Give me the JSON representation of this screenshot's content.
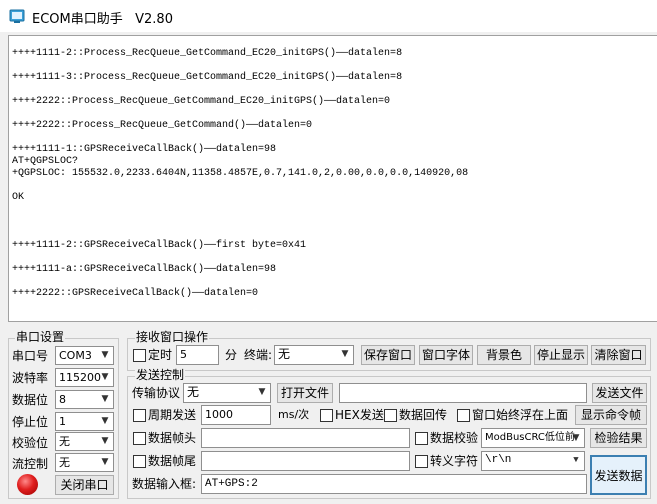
{
  "window": {
    "title": "ECOM串口助手   V2.80"
  },
  "receive": {
    "lines": [
      "++++1111-2::Process_RecQueue_GetCommand_EC20_initGPS()——datalen=8",
      "",
      "++++1111-3::Process_RecQueue_GetCommand_EC20_initGPS()——datalen=8",
      "",
      "++++2222::Process_RecQueue_GetCommand_EC20_initGPS()——datalen=0",
      "",
      "++++2222::Process_RecQueue_GetCommand()——datalen=0",
      "",
      "++++1111-1::GPSReceiveCallBack()——datalen=98",
      "AT+QGPSLOC?",
      "+QGPSLOC: 155532.0,2233.6404N,11358.4857E,0.7,141.0,2,0.00,0.0,0.0,140920,08",
      "",
      "OK",
      "",
      "",
      "",
      "++++1111-2::GPSReceiveCallBack()——first byte=0x41",
      "",
      "++++1111-a::GPSReceiveCallBack()——datalen=98",
      "",
      "++++2222::GPSReceiveCallBack()——datalen=0"
    ]
  },
  "serial_settings": {
    "group_label": "串口设置",
    "port_label": "串口号",
    "port_value": "COM3",
    "baud_label": "波特率",
    "baud_value": "115200",
    "databits_label": "数据位",
    "databits_value": "8",
    "stopbits_label": "停止位",
    "stopbits_value": "1",
    "parity_label": "校验位",
    "parity_value": "无",
    "flow_label": "流控制",
    "flow_value": "无",
    "close_button": "关闭串口"
  },
  "receive_ops": {
    "group_label": "接收窗口操作",
    "timer_label": "定时",
    "timer_value": "5",
    "unit": "分",
    "terminal_label": "终端:",
    "terminal_value": "无",
    "save_window": "保存窗口",
    "window_font": "窗口字体",
    "background": "背景色",
    "stop_display": "停止显示",
    "clear_window": "清除窗口"
  },
  "send_ops": {
    "group_label": "发送控制",
    "protocol_label": "传输协议",
    "protocol_value": "无",
    "open_file": "打开文件",
    "file_path": "",
    "send_file": "发送文件",
    "periodic_label": "周期发送",
    "period_value": "1000",
    "period_unit": "ms/次",
    "hex_send": "HEX发送",
    "echo": "数据回传",
    "always_top": "窗口始终浮在上面",
    "show_cmd": "显示命令帧",
    "frame_head_label": "数据帧头",
    "frame_head_value": "",
    "checksum_label": "数据校验",
    "checksum_value": "ModBusCRC低位前",
    "check_result": "检验结果",
    "frame_tail_label": "数据帧尾",
    "frame_tail_value": "",
    "escape_label": "转义字符",
    "escape_value": "\\r\\n",
    "input_label": "数据输入框:",
    "input_value": "AT+GPS:2",
    "send_button": "发送数据"
  }
}
